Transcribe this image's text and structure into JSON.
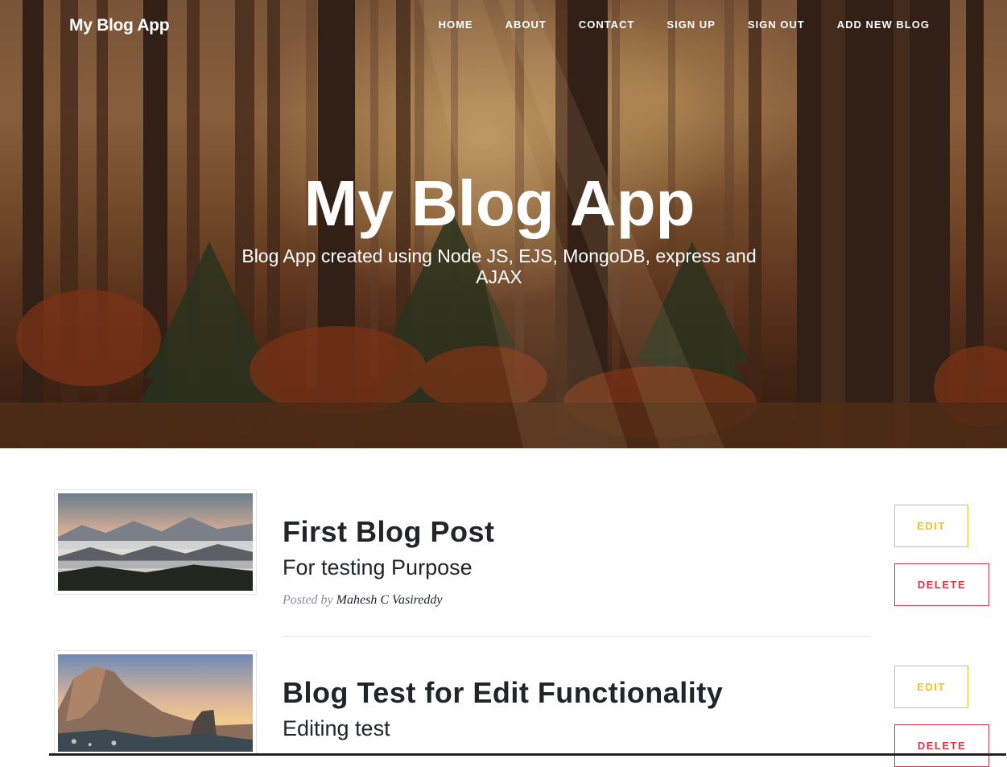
{
  "app": {
    "brand": "My Blog App",
    "nav": [
      "HOME",
      "ABOUT",
      "CONTACT",
      "SIGN UP",
      "SIGN OUT",
      "ADD NEW BLOG"
    ]
  },
  "hero": {
    "title": "My Blog App",
    "subtitle": "Blog App created using Node JS, EJS, MongoDB, express and AJAX"
  },
  "posts": [
    {
      "title": "First Blog Post",
      "subtitle": "For testing Purpose",
      "posted_by_label": "Posted by",
      "author": "Mahesh C Vasireddy",
      "edit_label": "EDIT",
      "delete_label": "DELETE",
      "image": "misty-mountains-image"
    },
    {
      "title": "Blog Test for Edit Functionality",
      "subtitle": "Editing test",
      "edit_label": "EDIT",
      "delete_label": "DELETE",
      "image": "rocky-mountain-sunset-image"
    }
  ],
  "colors": {
    "edit": "#f2c21a",
    "delete": "#d63a4a",
    "text": "#212529",
    "muted": "#868e96"
  }
}
